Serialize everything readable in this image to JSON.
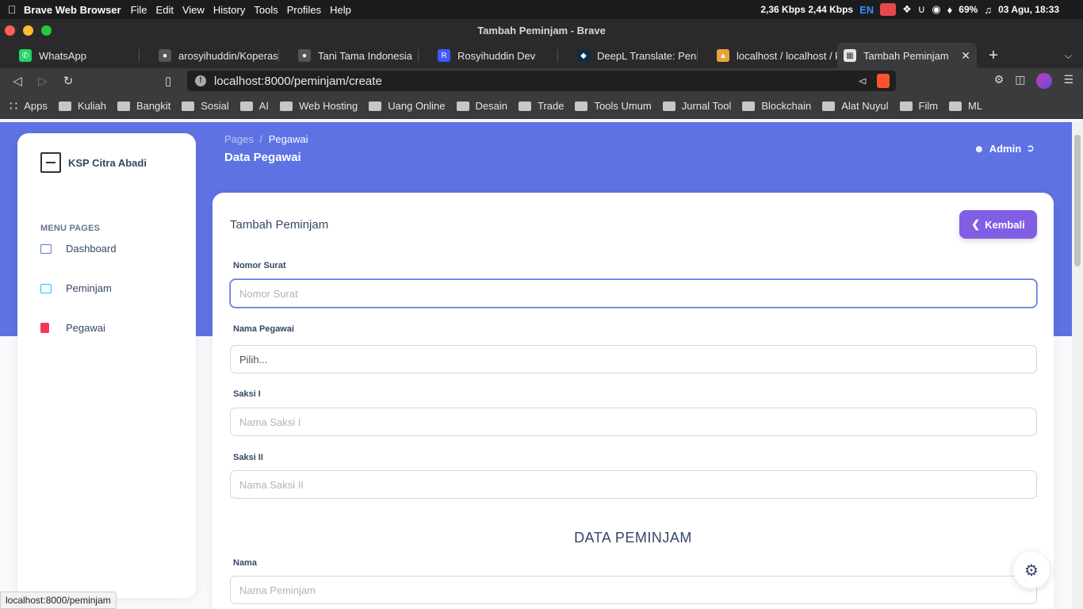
{
  "menubar": {
    "app_name": "Brave Web Browser",
    "menus": [
      "File",
      "Edit",
      "View",
      "History",
      "Tools",
      "Profiles",
      "Help"
    ],
    "network": "2,36 Kbps 2,44 Kbps",
    "lang": "EN",
    "battery": "69%",
    "datetime": "03 Agu, 18:33"
  },
  "window": {
    "title": "Tambah Peminjam - Brave"
  },
  "tabs": [
    {
      "label": "WhatsApp",
      "color": "#25d366"
    },
    {
      "label": "arosyihuddin/Koperasi-Si",
      "color": "#555555"
    },
    {
      "label": "Tani Tama Indonesia",
      "color": "#555555"
    },
    {
      "label": "Rosyihuddin Dev",
      "color": "#3d5afe"
    },
    {
      "label": "DeepL Translate: Penerje",
      "color": "#0f2b46"
    },
    {
      "label": "localhost / localhost / kop",
      "color": "#e8a33a"
    },
    {
      "label": "Tambah Peminjam",
      "color": "#3b3b3d"
    }
  ],
  "address": {
    "url": "localhost:8000/peminjam/create"
  },
  "bookmarks": [
    "Kuliah",
    "Bangkit",
    "Sosial",
    "AI",
    "Web Hosting",
    "Uang Online",
    "Desain",
    "Trade",
    "Tools Umum",
    "Jurnal Tool",
    "Blockchain",
    "Alat Nuyul",
    "Film",
    "ML"
  ],
  "bookmarks_apps": "Apps",
  "sidebar": {
    "brand": "KSP Citra Abadi",
    "section_title": "MENU PAGES",
    "items": [
      {
        "label": "Dashboard",
        "color": "#5e72e4"
      },
      {
        "label": "Peminjam",
        "color": "#11cdef"
      },
      {
        "label": "Pegawai",
        "color": "#f5365c"
      }
    ]
  },
  "header": {
    "breadcrumb_root": "Pages",
    "breadcrumb_sep": "/",
    "breadcrumb_current": "Pegawai",
    "title": "Data Pegawai",
    "user": "Admin"
  },
  "form": {
    "title": "Tambah Peminjam",
    "back_label": "Kembali",
    "nomor_surat": {
      "label": "Nomor Surat",
      "placeholder": "Nomor Surat"
    },
    "nama_pegawai": {
      "label": "Nama Pegawai",
      "value": "Pilih..."
    },
    "saksi1": {
      "label": "Saksi I",
      "placeholder": "Nama Saksi I"
    },
    "saksi2": {
      "label": "Saksi II",
      "placeholder": "Nama Saksi II"
    },
    "section_title": "DATA PEMINJAM",
    "nama": {
      "label": "Nama",
      "placeholder": "Nama Peminjam"
    }
  },
  "statusbar": {
    "url": "localhost:8000/peminjam"
  },
  "colors": {
    "primary": "#5e72e4",
    "button": "#825ee4"
  }
}
